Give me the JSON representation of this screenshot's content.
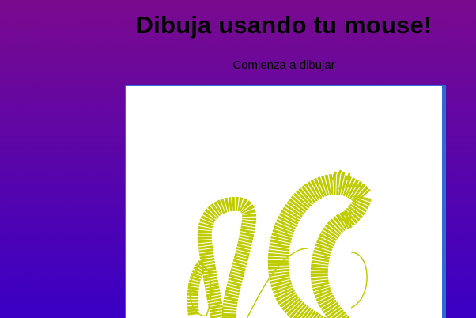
{
  "header": {
    "title": "Dibuja usando tu mouse!",
    "subtitle": "Comienza a dibujar"
  },
  "canvas": {
    "background": "#ffffff",
    "frame_color": "#2f6bd8",
    "stroke_color": "#bfcc00"
  },
  "theme": {
    "gradient_top": "#7a0a8e",
    "gradient_bottom": "#3a00c4"
  }
}
